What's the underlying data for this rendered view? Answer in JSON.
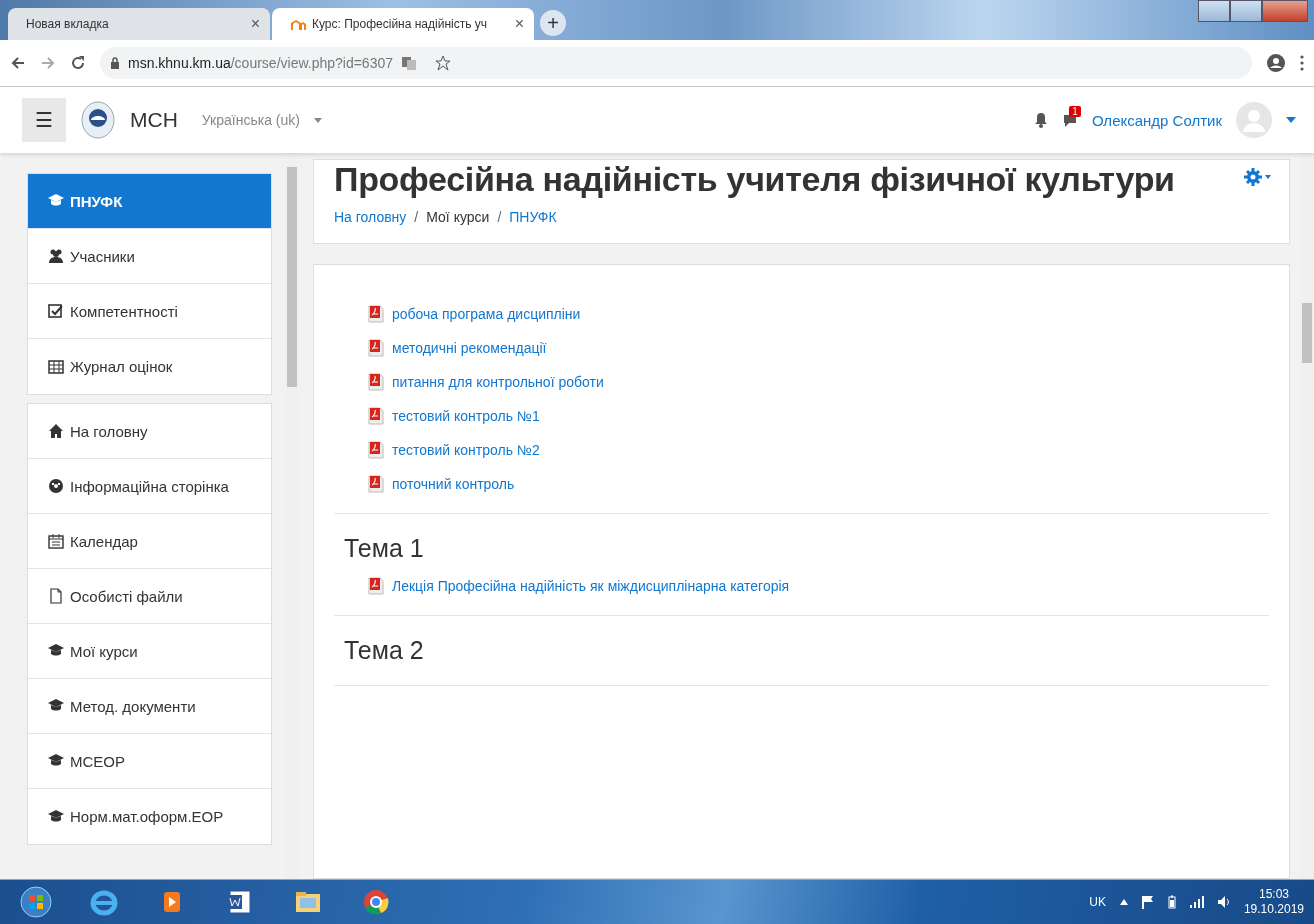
{
  "browser_tabs": [
    {
      "label": "Новая вкладка",
      "selected": false,
      "close": "×"
    },
    {
      "label": "Курс: Професійна надійність уч",
      "selected": true,
      "close": "×"
    }
  ],
  "new_tab": "+",
  "address": {
    "host": "msn.khnu.km.ua",
    "path": "/course/view.php?id=6307"
  },
  "navbar": {
    "menu": "☰",
    "site_name": "МСН",
    "language": "Українська (uk)",
    "message_count": "1",
    "user_name": "Олександр Солтик"
  },
  "sidebar": {
    "groups": [
      [
        {
          "label": "ПНУФК",
          "selected": true
        },
        {
          "label": "Учасники",
          "selected": false
        },
        {
          "label": "Компетентності",
          "selected": false
        },
        {
          "label": "Журнал оцінок",
          "selected": false
        }
      ],
      [
        {
          "label": "На головну",
          "selected": false
        },
        {
          "label": "Інформаційна сторінка",
          "selected": false
        },
        {
          "label": "Календар",
          "selected": false
        },
        {
          "label": "Особисті файли",
          "selected": false
        },
        {
          "label": "Мої курси",
          "selected": false
        },
        {
          "label": "Метод. документи",
          "selected": false
        },
        {
          "label": "МСЕОР",
          "selected": false
        },
        {
          "label": "Норм.мат.оформ.ЕОР",
          "selected": false
        }
      ]
    ]
  },
  "course": {
    "title": "Професійна надійність учителя фізичної культури",
    "breadcrumb_separator": "/",
    "breadcrumb": [
      {
        "label": "На головну",
        "link": true
      },
      {
        "label": "Мої курси",
        "link": false
      },
      {
        "label": "ПНУФК",
        "link": true
      }
    ],
    "sections": [
      {
        "resources": [
          "робоча програма дисципліни",
          "методичні рекомендації",
          "питання для контрольної роботи",
          "тестовий контроль №1",
          "тестовий контроль №2",
          "поточний контроль"
        ]
      },
      {
        "title": "Тема 1",
        "resources": [
          "Лекція Професійна надійність як міждисциплінарна категорія"
        ]
      },
      {
        "title": "Тема 2"
      }
    ]
  },
  "taskbar": {
    "language": "UK",
    "time": "15:03",
    "date": "19.10.2019"
  }
}
